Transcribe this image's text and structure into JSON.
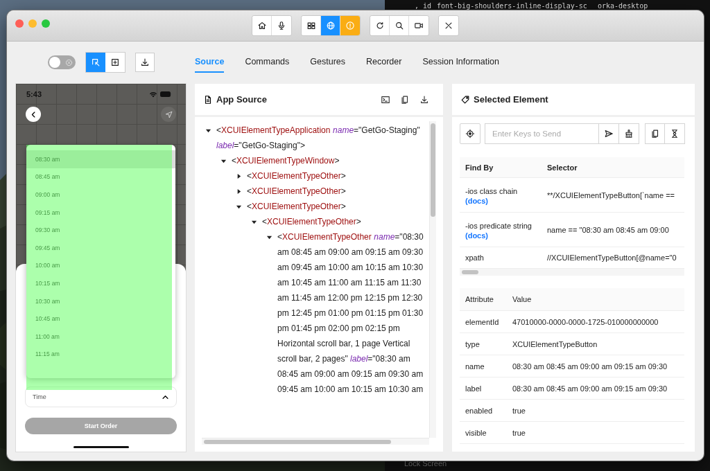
{
  "desktop": {
    "terminal_lines": [
      ", id",
      "font-big-shoulders-inline-display-sc",
      "orka-desktop"
    ],
    "dock_item": "Lock Screen"
  },
  "toolbar": {
    "groups": [
      {
        "buttons": [
          {
            "kind": "home",
            "selected": false,
            "alert": false
          },
          {
            "kind": "mic",
            "selected": false,
            "alert": false
          }
        ]
      },
      {
        "buttons": [
          {
            "kind": "grid",
            "selected": false,
            "alert": false
          },
          {
            "kind": "globe",
            "selected": true,
            "alert": false
          },
          {
            "kind": "info",
            "selected": false,
            "alert": true
          }
        ]
      },
      {
        "buttons": [
          {
            "kind": "refresh",
            "selected": false,
            "alert": false
          },
          {
            "kind": "search",
            "selected": false,
            "alert": false
          },
          {
            "kind": "video",
            "selected": false,
            "alert": false
          }
        ]
      },
      {
        "buttons": [
          {
            "kind": "close",
            "selected": false,
            "alert": false
          }
        ]
      }
    ]
  },
  "inspector": {
    "screenshot_toggle": {
      "on": false
    },
    "mode_buttons": [
      {
        "kind": "select",
        "selected": true
      },
      {
        "kind": "add",
        "selected": false
      }
    ]
  },
  "tabs": [
    {
      "label": "Source",
      "selected": true
    },
    {
      "label": "Commands",
      "selected": false
    },
    {
      "label": "Gestures",
      "selected": false
    },
    {
      "label": "Recorder",
      "selected": false
    },
    {
      "label": "Session Information",
      "selected": false
    }
  ],
  "device": {
    "status_time": "5:43",
    "dropdown": {
      "items": [
        {
          "label": "08:30 am",
          "selected": true
        },
        {
          "label": "08:45 am",
          "selected": false
        },
        {
          "label": "09:00 am",
          "selected": false
        },
        {
          "label": "09:15 am",
          "selected": false
        },
        {
          "label": "09:30 am",
          "selected": false
        },
        {
          "label": "09:45 am",
          "selected": false
        },
        {
          "label": "10:00 am",
          "selected": false
        },
        {
          "label": "10:15 am",
          "selected": false
        },
        {
          "label": "10:30 am",
          "selected": false
        },
        {
          "label": "10:45 am",
          "selected": false
        },
        {
          "label": "11:00 am",
          "selected": false
        },
        {
          "label": "11:15 am",
          "selected": false
        }
      ]
    },
    "time_field": {
      "label": "Time",
      "expanded": true
    },
    "start_button": {
      "label": "Start Order",
      "disabled": true
    }
  },
  "app_source": {
    "title": "App Source",
    "tree": [
      {
        "expanded": true,
        "segments": [
          {
            "kind": "text",
            "text": "<"
          },
          {
            "kind": "tag",
            "text": "XCUIElementTypeApplication"
          },
          {
            "kind": "attr",
            "text": "name"
          },
          {
            "kind": "text",
            "text": "=\"GetGo-Staging\" "
          },
          {
            "kind": "attr",
            "text": "label"
          },
          {
            "kind": "text",
            "text": "=\"GetGo-Staging\">"
          }
        ],
        "children": [
          {
            "expanded": true,
            "segments": [
              {
                "kind": "text",
                "text": "<"
              },
              {
                "kind": "tag",
                "text": "XCUIElementTypeWindow"
              },
              {
                "kind": "text",
                "text": ">"
              }
            ],
            "children": [
              {
                "expanded": false,
                "segments": [
                  {
                    "kind": "text",
                    "text": "<"
                  },
                  {
                    "kind": "tag",
                    "text": "XCUIElementTypeOther"
                  },
                  {
                    "kind": "text",
                    "text": ">"
                  }
                ]
              },
              {
                "expanded": false,
                "segments": [
                  {
                    "kind": "text",
                    "text": "<"
                  },
                  {
                    "kind": "tag",
                    "text": "XCUIElementTypeOther"
                  },
                  {
                    "kind": "text",
                    "text": ">"
                  }
                ]
              },
              {
                "expanded": true,
                "segments": [
                  {
                    "kind": "text",
                    "text": "<"
                  },
                  {
                    "kind": "tag",
                    "text": "XCUIElementTypeOther"
                  },
                  {
                    "kind": "text",
                    "text": ">"
                  }
                ],
                "children": [
                  {
                    "expanded": true,
                    "segments": [
                      {
                        "kind": "text",
                        "text": "<"
                      },
                      {
                        "kind": "tag",
                        "text": "XCUIElementTypeOther"
                      },
                      {
                        "kind": "text",
                        "text": ">"
                      }
                    ],
                    "children": [
                      {
                        "expanded": true,
                        "segments": [
                          {
                            "kind": "text",
                            "text": "<"
                          },
                          {
                            "kind": "tag",
                            "text": "XCUIElementTypeOther"
                          },
                          {
                            "kind": "attr",
                            "text": "name"
                          },
                          {
                            "kind": "text",
                            "text": "=\"08:30 am 08:45 am 09:00 am 09:15 am 09:30 am 09:45 am 10:00 am 10:15 am 10:30 am 10:45 am 11:00 am 11:15 am 11:30 am 11:45 am 12:00 pm 12:15 pm 12:30 pm 12:45 pm 01:00 pm 01:15 pm 01:30 pm 01:45 pm 02:00 pm 02:15 pm Horizontal scroll bar, 1 page Vertical scroll bar, 2 pages\" "
                          },
                          {
                            "kind": "attr",
                            "text": "label"
                          },
                          {
                            "kind": "text",
                            "text": "=\"08:30 am 08:45 am 09:00 am 09:15 am 09:30 am 09:45 am 10:00 am 10:15 am 10:30 am"
                          }
                        ]
                      }
                    ]
                  }
                ]
              }
            ]
          }
        ]
      }
    ]
  },
  "selected_element": {
    "title": "Selected Element",
    "keys_field": {
      "placeholder": "Enter Keys to Send"
    },
    "selectors": {
      "columns": [
        "Find By",
        "Selector"
      ],
      "rows": [
        {
          "find_by": "-ios class chain",
          "docs": "(docs)",
          "selector": "**/XCUIElementTypeButton[`name =="
        },
        {
          "find_by": "-ios predicate string",
          "docs": "(docs)",
          "selector": "name == \"08:30 am 08:45 am 09:00"
        },
        {
          "find_by": "xpath",
          "selector": "//XCUIElementTypeButton[@name=\"0"
        }
      ]
    },
    "attributes": {
      "columns": [
        "Attribute",
        "Value"
      ],
      "rows": [
        {
          "attribute": "elementId",
          "value": "47010000-0000-0000-1725-010000000000"
        },
        {
          "attribute": "type",
          "value": "XCUIElementTypeButton"
        },
        {
          "attribute": "name",
          "value": "08:30 am 08:45 am 09:00 am 09:15 am 09:30"
        },
        {
          "attribute": "label",
          "value": "08:30 am 08:45 am 09:00 am 09:15 am 09:30"
        },
        {
          "attribute": "enabled",
          "value": "true"
        },
        {
          "attribute": "visible",
          "value": "true"
        }
      ]
    }
  }
}
